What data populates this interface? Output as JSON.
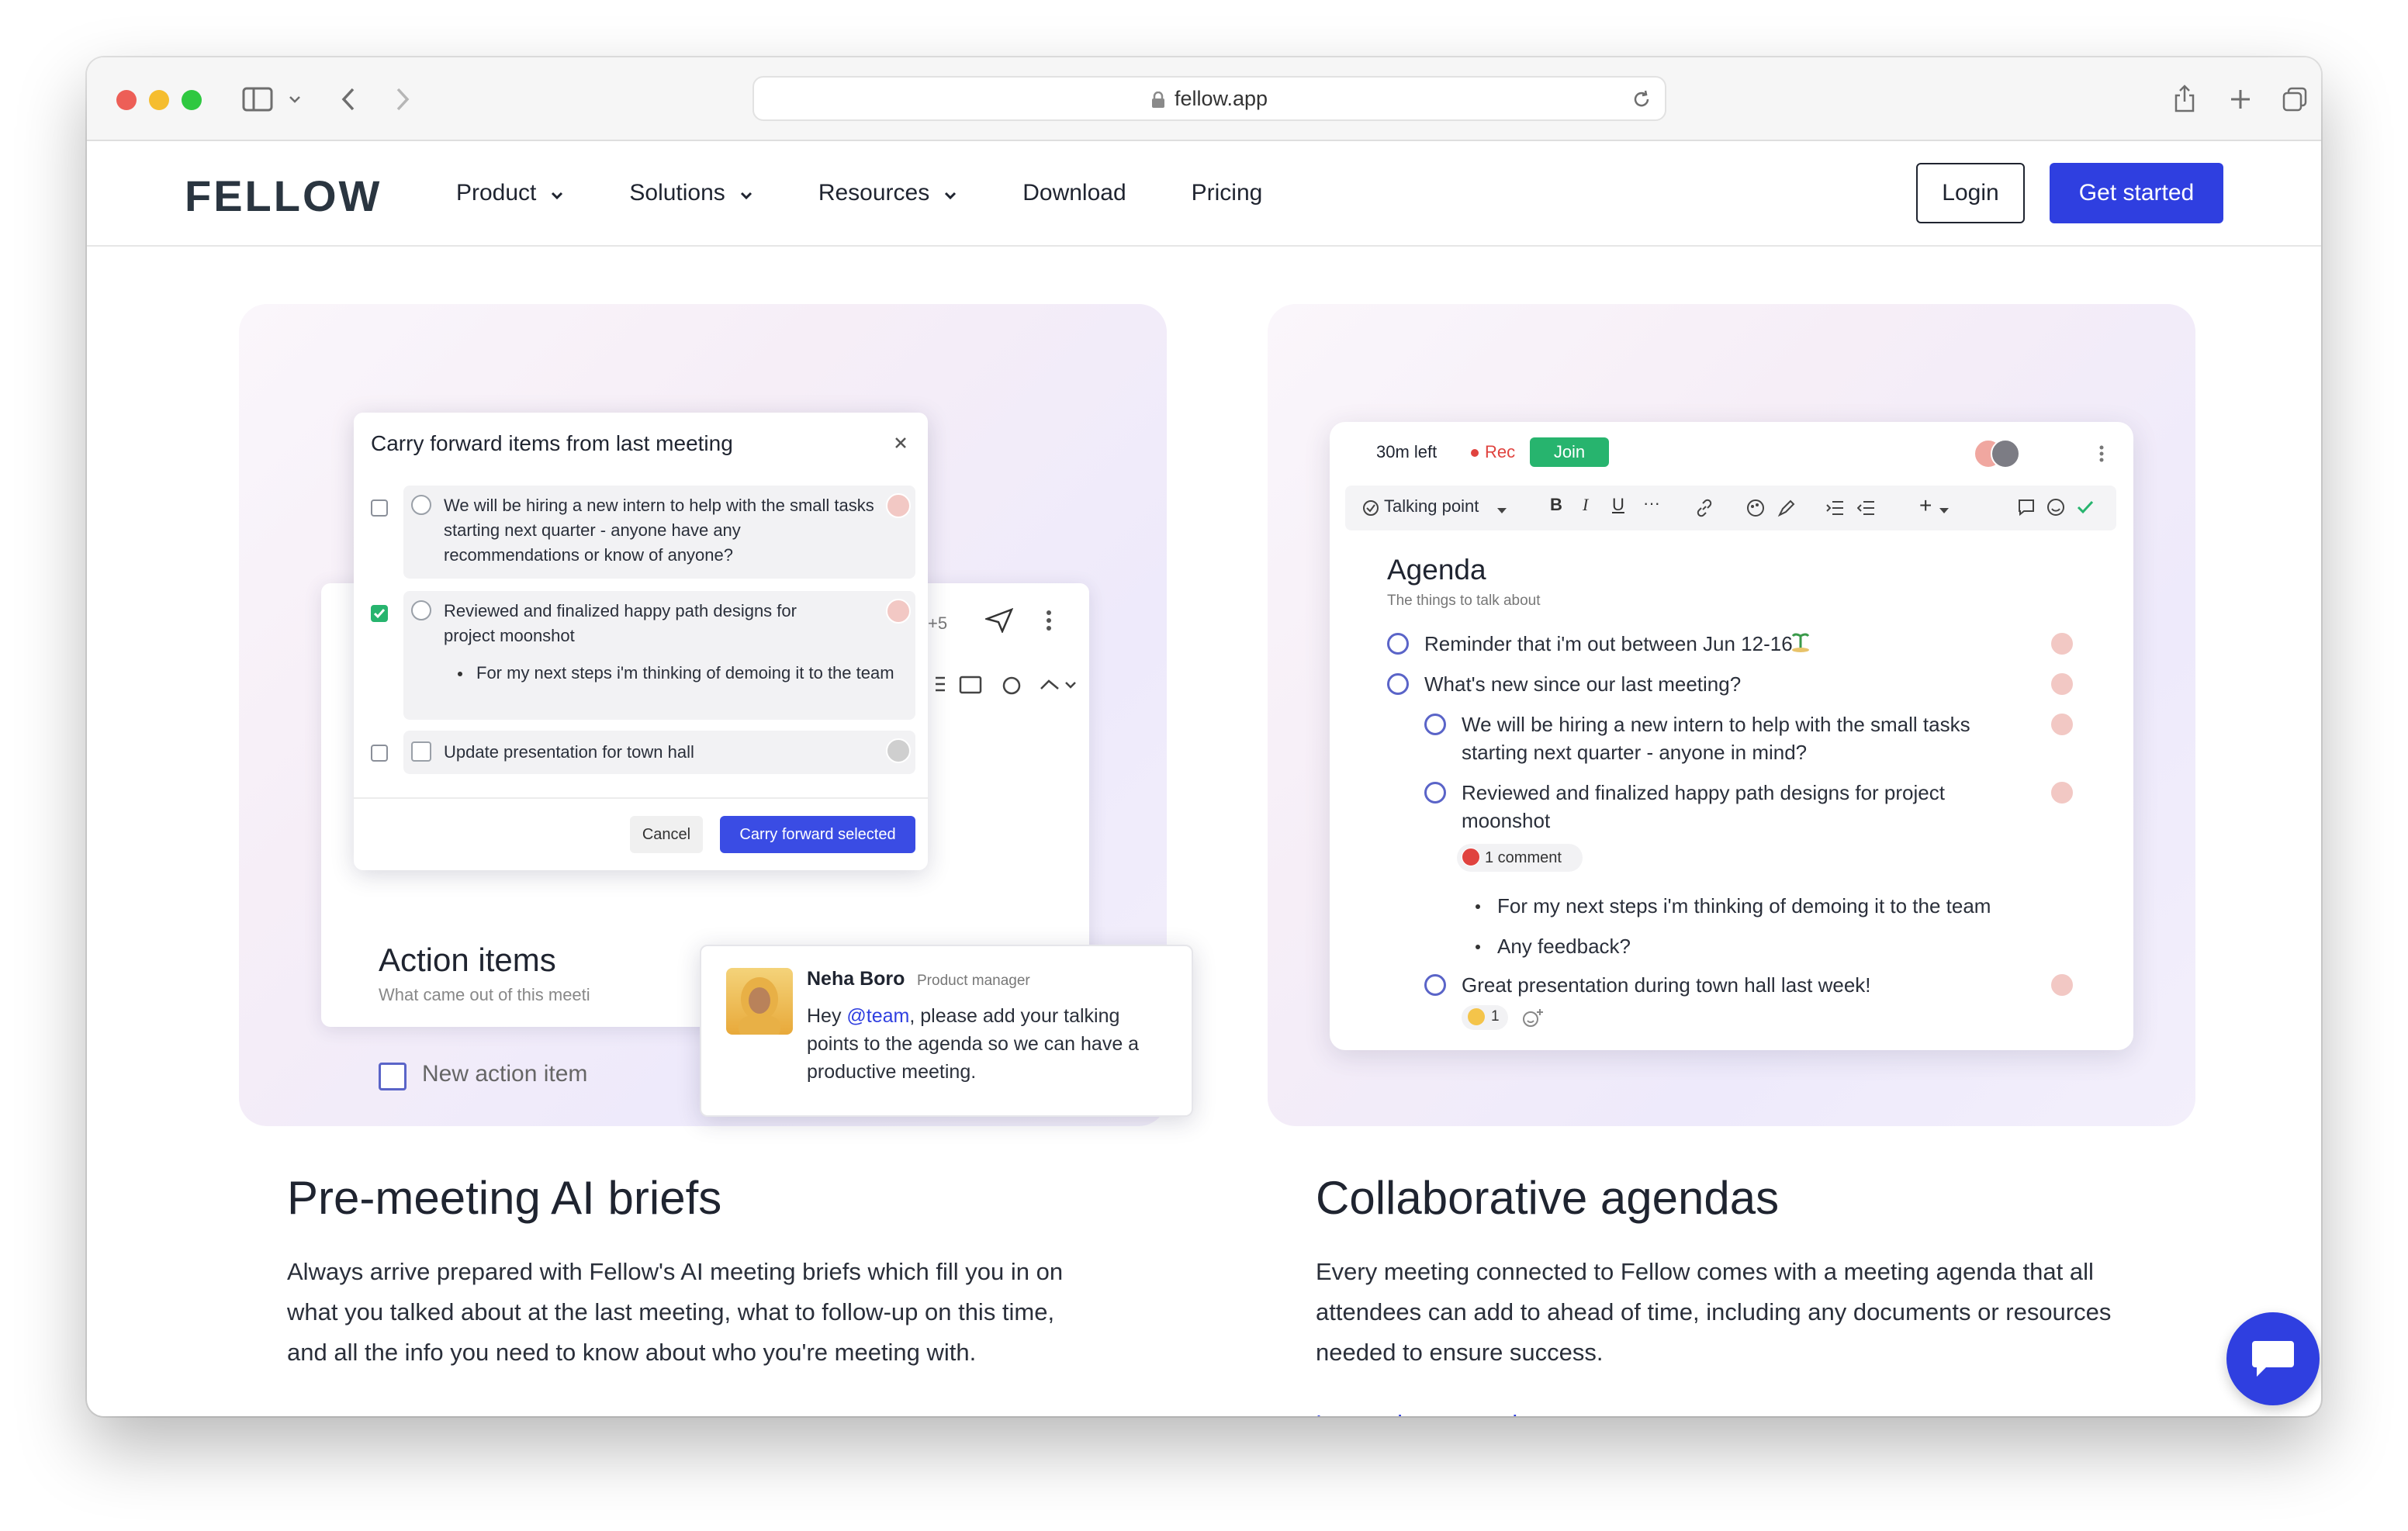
{
  "browser": {
    "url": "fellow.app"
  },
  "nav": {
    "logo": "FELLOW",
    "links": [
      "Product",
      "Solutions",
      "Resources",
      "Download",
      "Pricing"
    ],
    "login": "Login",
    "get_started": "Get started"
  },
  "left_card": {
    "modal_title": "Carry forward items from last meeting",
    "items": [
      "We will be hiring a new intern to help with the small tasks starting next quarter - anyone have any recommendations or know of anyone?",
      "Reviewed and finalized happy path designs for project moonshot",
      "For my next steps i'm thinking of demoing it to the team",
      "Update presentation for town hall"
    ],
    "cancel": "Cancel",
    "carry_forward": "Carry forward selected",
    "plus_count": "+5",
    "action_items_title": "Action items",
    "action_items_sub": "What came out of this meeti",
    "new_action_item": "New action item",
    "comment": {
      "name": "Neha Boro",
      "role": "Product manager",
      "mention": "@team",
      "text_before": "Hey ",
      "text_after": ", please add your talking points to the agenda so we can have a productive meeting."
    }
  },
  "right_card": {
    "time_left": "30m left",
    "rec": "Rec",
    "join": "Join",
    "talking_point": "Talking point",
    "agenda_title": "Agenda",
    "agenda_sub": "The things to talk about",
    "items": [
      "Reminder that i'm out between Jun 12-16",
      "What's new since our last meeting?",
      "We will be hiring a new intern to help with the small tasks starting next quarter - anyone in mind?",
      "Reviewed and finalized happy path designs for project moonshot",
      "1 comment",
      "For my next steps i'm thinking of demoing it to the team",
      "Any feedback?",
      "Great presentation during town hall last week!"
    ],
    "reaction_count": "1"
  },
  "sections": {
    "left_title": "Pre-meeting AI briefs",
    "left_text": "Always arrive prepared with Fellow's AI meeting briefs which fill you in on what you talked about at the last meeting, what to follow-up on this time, and all the info you need to know about who you're meeting with.",
    "right_title": "Collaborative agendas",
    "right_text": "Every meeting connected to Fellow comes with a meeting agenda that all attendees can add to ahead of time, including any documents or resources needed to ensure success.",
    "right_link": "Learn about agendas"
  },
  "colors": {
    "brand_blue": "#2f3fe0",
    "join_green": "#27b46e",
    "rec_red": "#e0433f"
  }
}
